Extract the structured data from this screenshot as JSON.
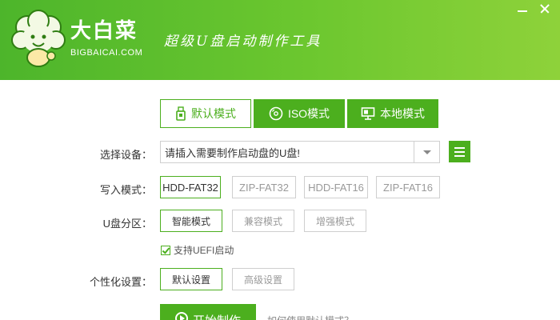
{
  "header": {
    "brand_cn": "大白菜",
    "brand_en": "BIGBAICAI.COM",
    "slogan": "超级U盘启动制作工具"
  },
  "tabs": [
    {
      "label": "默认模式",
      "icon": "usb-drive-icon",
      "active": true
    },
    {
      "label": "ISO模式",
      "icon": "disc-icon",
      "active": false
    },
    {
      "label": "本地模式",
      "icon": "monitor-icon",
      "active": false
    }
  ],
  "device": {
    "label": "选择设备：",
    "value": "请插入需要制作启动盘的U盘!"
  },
  "write_mode": {
    "label": "写入模式：",
    "options": [
      "HDD-FAT32",
      "ZIP-FAT32",
      "HDD-FAT16",
      "ZIP-FAT16"
    ],
    "selected": "HDD-FAT32"
  },
  "partition": {
    "label": "U盘分区：",
    "options": [
      "智能模式",
      "兼容模式",
      "增强模式"
    ],
    "selected": "智能模式"
  },
  "uefi": {
    "label": "支持UEFI启动",
    "checked": true
  },
  "personalize": {
    "label": "个性化设置：",
    "options": [
      "默认设置",
      "高级设置"
    ],
    "selected": "默认设置"
  },
  "actions": {
    "start_label": "开始制作",
    "help_link": "如何使用默认模式？"
  },
  "colors": {
    "accent": "#4caf1e",
    "header_start": "#4db52b",
    "header_end": "#8ed23a"
  }
}
